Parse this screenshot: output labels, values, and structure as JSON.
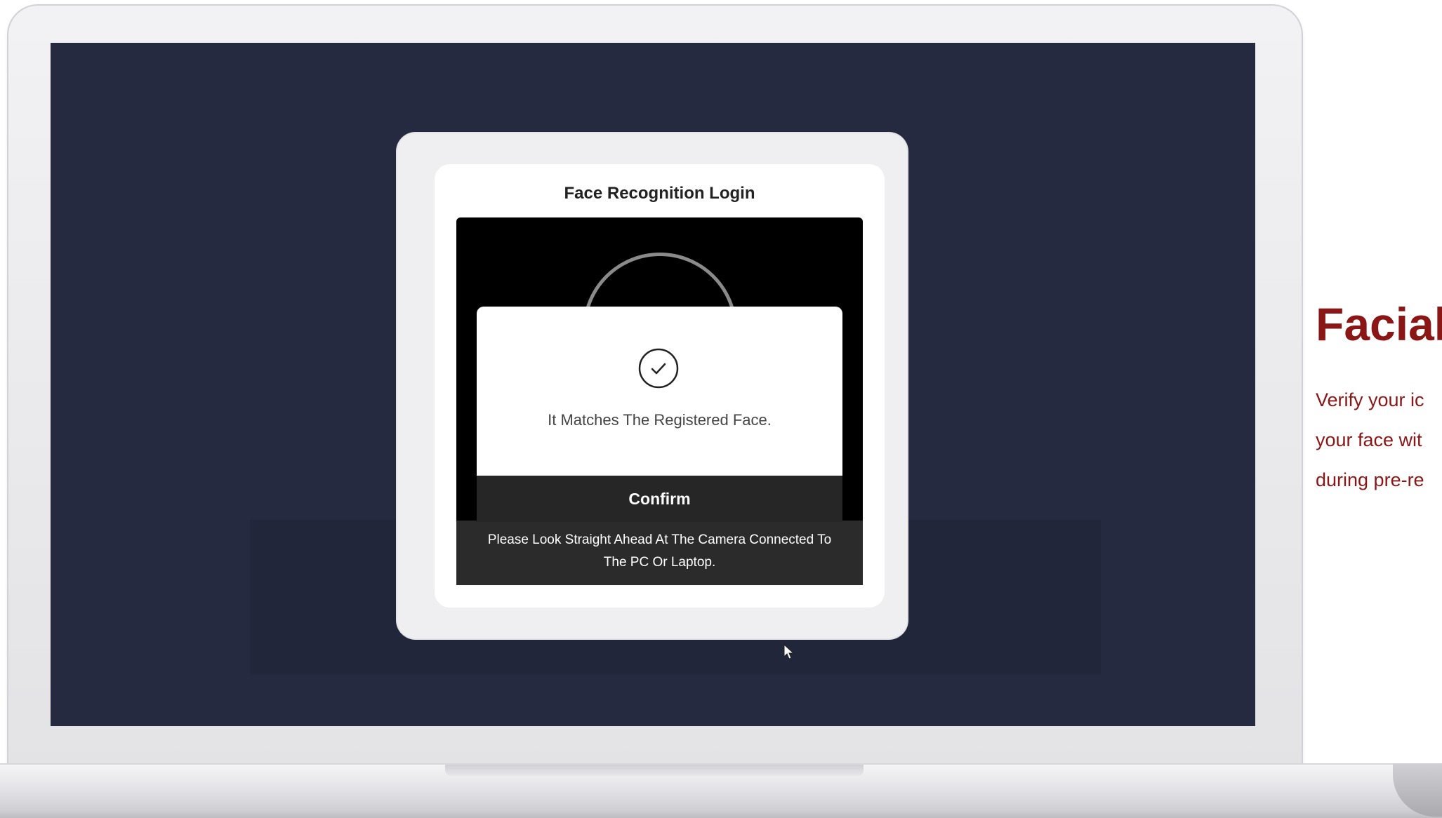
{
  "dialog": {
    "title": "Face Recognition Login",
    "result_message": "It Matches The Registered Face.",
    "confirm_label": "Confirm",
    "instruction_line1": "Please Look Straight Ahead At The Camera Connected To",
    "instruction_line2": "The PC Or Laptop."
  },
  "side_panel": {
    "title": "Facial",
    "desc_line1": "Verify your ic",
    "desc_line2": "your face wit",
    "desc_line3": "during pre-re"
  },
  "icons": {
    "check": "check-circle-icon",
    "cursor": "mouse-cursor-icon"
  },
  "colors": {
    "screen_bg": "#262a40",
    "accent_red": "#8a1616",
    "confirm_bg": "#262626"
  }
}
